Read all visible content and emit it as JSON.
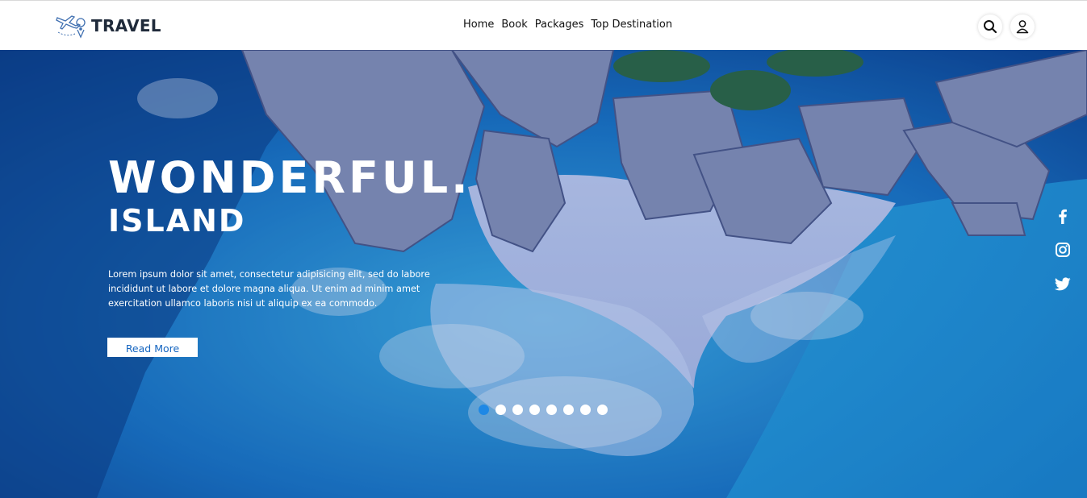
{
  "header": {
    "logo_text": "TRAVEL",
    "nav": [
      "Home",
      "Book",
      "Packages",
      "Top Destination"
    ],
    "icons": [
      "search-icon",
      "user-icon"
    ]
  },
  "hero": {
    "title": "WONDERFUL.",
    "subtitle": "ISLAND",
    "description": "Lorem ipsum dolor sit amet, consectetur adipisicing elit, sed do labore incididunt ut labore et dolore magna aliqua. Ut enim ad minim amet exercitation ullamco laboris nisi ut aliquip ex ea commodo.",
    "button_label": "Read More",
    "slides_count": 8,
    "active_slide": 1
  },
  "social": [
    "facebook-icon",
    "instagram-icon",
    "twitter-icon"
  ],
  "colors": {
    "accent": "#1e88e5",
    "button_text": "#1565c0",
    "logo_text": "#1f2a3a"
  }
}
